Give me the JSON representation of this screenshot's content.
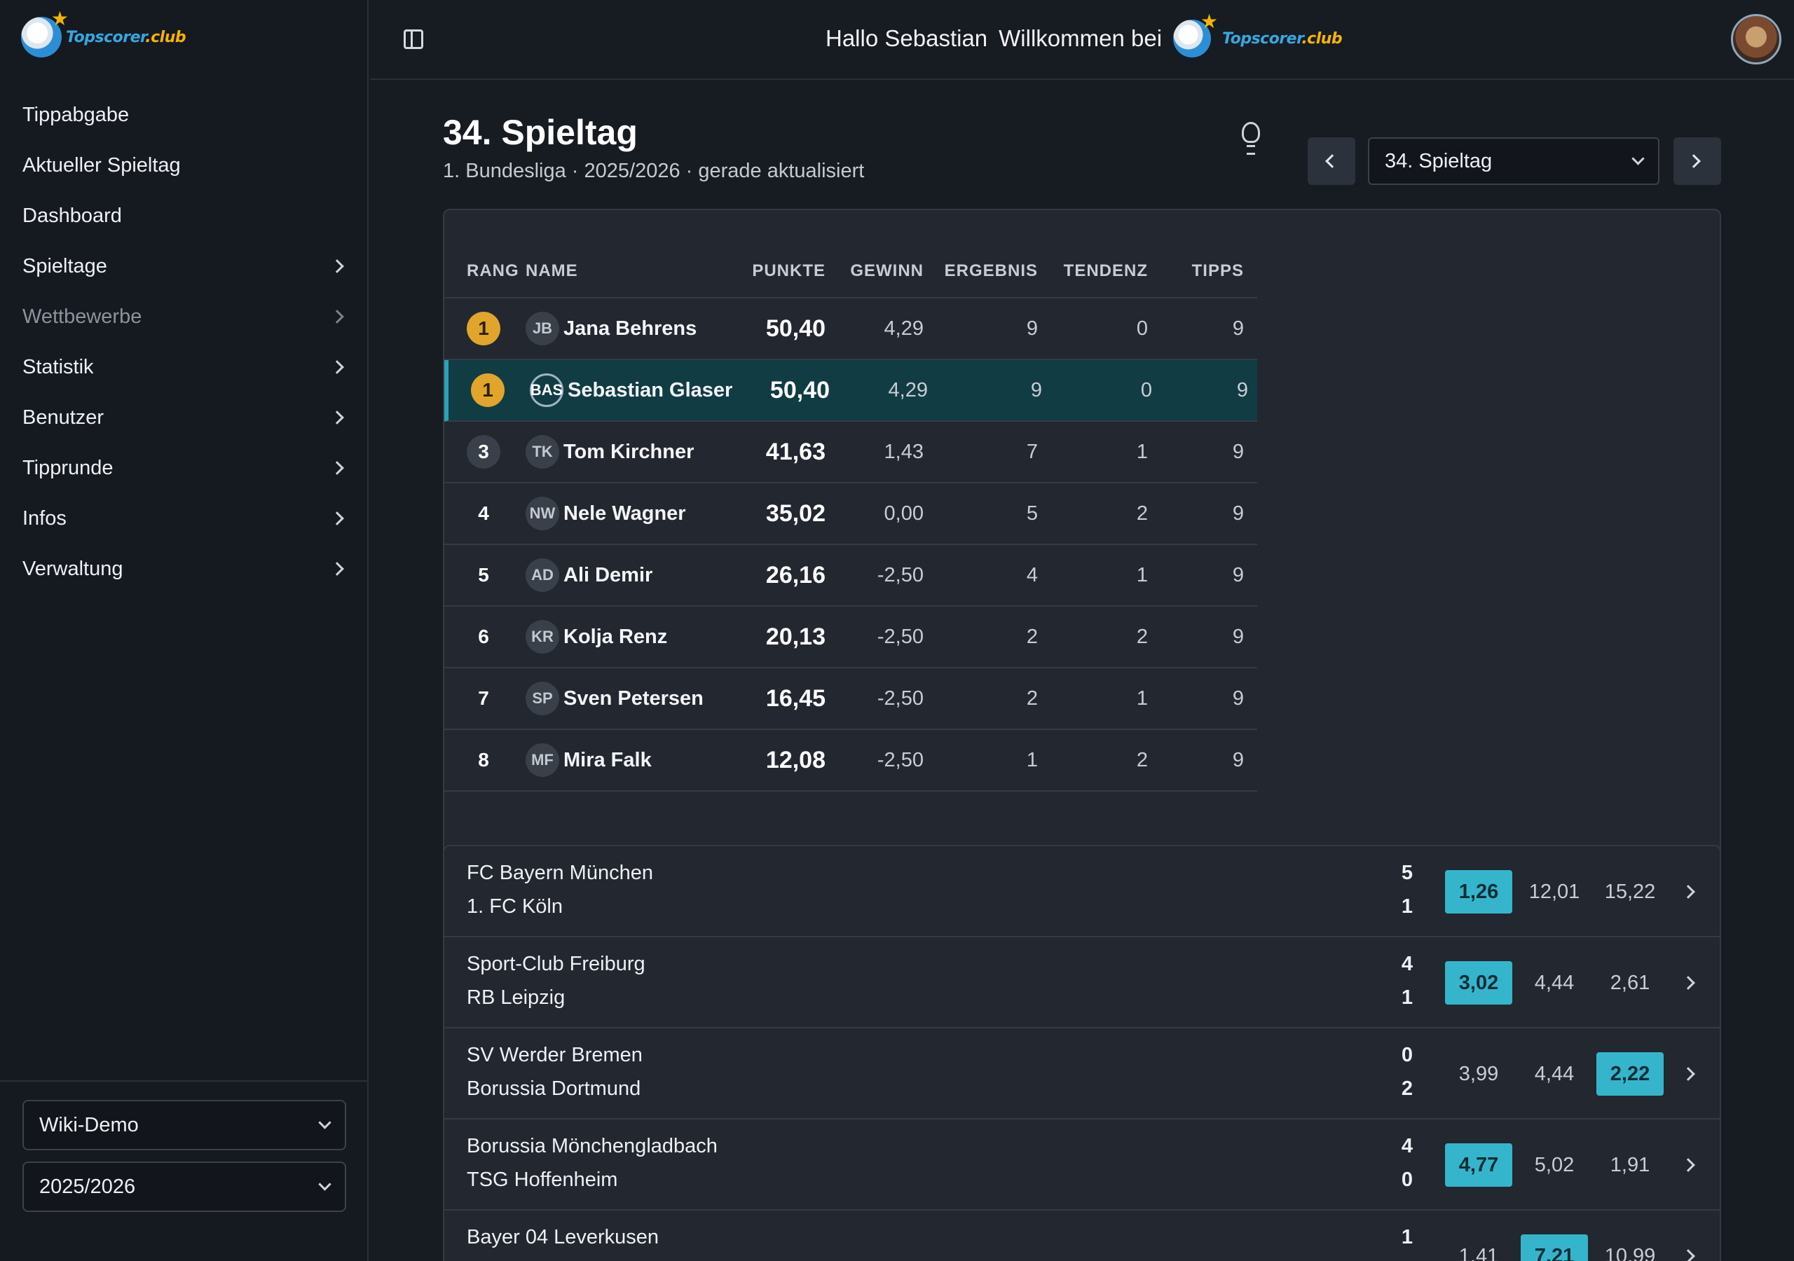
{
  "brand": {
    "logo_main": "Topscorer",
    "logo_suffix": ".club"
  },
  "header": {
    "greeting": "Hallo Sebastian",
    "welcome": "Willkommen bei"
  },
  "sidebar": {
    "items": [
      {
        "label": "Tippabgabe",
        "chevron": false,
        "muted": false
      },
      {
        "label": "Aktueller Spieltag",
        "chevron": false,
        "muted": false
      },
      {
        "label": "Dashboard",
        "chevron": false,
        "muted": false
      },
      {
        "label": "Spieltage",
        "chevron": true,
        "muted": false
      },
      {
        "label": "Wettbewerbe",
        "chevron": true,
        "muted": true
      },
      {
        "label": "Statistik",
        "chevron": true,
        "muted": false
      },
      {
        "label": "Benutzer",
        "chevron": true,
        "muted": false
      },
      {
        "label": "Tipprunde",
        "chevron": true,
        "muted": false
      },
      {
        "label": "Infos",
        "chevron": true,
        "muted": false
      },
      {
        "label": "Verwaltung",
        "chevron": true,
        "muted": false
      }
    ],
    "group_select": "Wiki-Demo",
    "season_select": "2025/2026"
  },
  "page": {
    "title": "34. Spieltag",
    "subtitle": "1. Bundesliga · 2025/2026 · gerade aktualisiert",
    "matchday_select": "34. Spieltag"
  },
  "ranking": {
    "headers": {
      "rang": "RANG",
      "name": "NAME",
      "punkte": "PUNKTE",
      "gewinn": "GEWINN",
      "ergebnis": "ERGEBNIS",
      "tendenz": "TENDENZ",
      "tipps": "TIPPS"
    },
    "rows": [
      {
        "rang": "1",
        "badge": "gold",
        "initials": "JB",
        "name": "Jana Behrens",
        "punkte": "50,40",
        "gewinn": "4,29",
        "ergebnis": "9",
        "tendenz": "0",
        "tipps": "9",
        "me": false
      },
      {
        "rang": "1",
        "badge": "gold",
        "initials": "BAS",
        "name": "Sebastian Glaser",
        "punkte": "50,40",
        "gewinn": "4,29",
        "ergebnis": "9",
        "tendenz": "0",
        "tipps": "9",
        "me": true
      },
      {
        "rang": "3",
        "badge": "grey",
        "initials": "TK",
        "name": "Tom Kirchner",
        "punkte": "41,63",
        "gewinn": "1,43",
        "ergebnis": "7",
        "tendenz": "1",
        "tipps": "9",
        "me": false
      },
      {
        "rang": "4",
        "badge": "plain",
        "initials": "NW",
        "name": "Nele Wagner",
        "punkte": "35,02",
        "gewinn": "0,00",
        "ergebnis": "5",
        "tendenz": "2",
        "tipps": "9",
        "me": false
      },
      {
        "rang": "5",
        "badge": "plain",
        "initials": "AD",
        "name": "Ali Demir",
        "punkte": "26,16",
        "gewinn": "-2,50",
        "ergebnis": "4",
        "tendenz": "1",
        "tipps": "9",
        "me": false
      },
      {
        "rang": "6",
        "badge": "plain",
        "initials": "KR",
        "name": "Kolja Renz",
        "punkte": "20,13",
        "gewinn": "-2,50",
        "ergebnis": "2",
        "tendenz": "2",
        "tipps": "9",
        "me": false
      },
      {
        "rang": "7",
        "badge": "plain",
        "initials": "SP",
        "name": "Sven Petersen",
        "punkte": "16,45",
        "gewinn": "-2,50",
        "ergebnis": "2",
        "tendenz": "1",
        "tipps": "9",
        "me": false
      },
      {
        "rang": "8",
        "badge": "plain",
        "initials": "MF",
        "name": "Mira Falk",
        "punkte": "12,08",
        "gewinn": "-2,50",
        "ergebnis": "1",
        "tendenz": "2",
        "tipps": "9",
        "me": false
      }
    ]
  },
  "matches": [
    {
      "home": "FC Bayern München",
      "away": "1. FC Köln",
      "home_goals": "5",
      "away_goals": "1",
      "odds": [
        "1,26",
        "12,01",
        "15,22"
      ],
      "hit": 0
    },
    {
      "home": "Sport-Club Freiburg",
      "away": "RB Leipzig",
      "home_goals": "4",
      "away_goals": "1",
      "odds": [
        "3,02",
        "4,44",
        "2,61"
      ],
      "hit": 0
    },
    {
      "home": "SV Werder Bremen",
      "away": "Borussia Dortmund",
      "home_goals": "0",
      "away_goals": "2",
      "odds": [
        "3,99",
        "4,44",
        "2,22"
      ],
      "hit": 2
    },
    {
      "home": "Borussia Mönchengladbach",
      "away": "TSG Hoffenheim",
      "home_goals": "4",
      "away_goals": "0",
      "odds": [
        "4,77",
        "5,02",
        "1,91"
      ],
      "hit": 0
    },
    {
      "home": "Bayer 04 Leverkusen",
      "away": "",
      "home_goals": "1",
      "away_goals": "",
      "odds": [
        "1,41",
        "7,21",
        "10,99"
      ],
      "hit": 1
    }
  ],
  "colors": {
    "accent": "#35b5cc",
    "gold": "#e0a52a",
    "highlight_row": "#113c44"
  },
  "icons": [
    "panel-toggle-icon",
    "lightbulb-icon",
    "chevron-left-icon",
    "chevron-right-icon",
    "chevron-down-icon"
  ]
}
